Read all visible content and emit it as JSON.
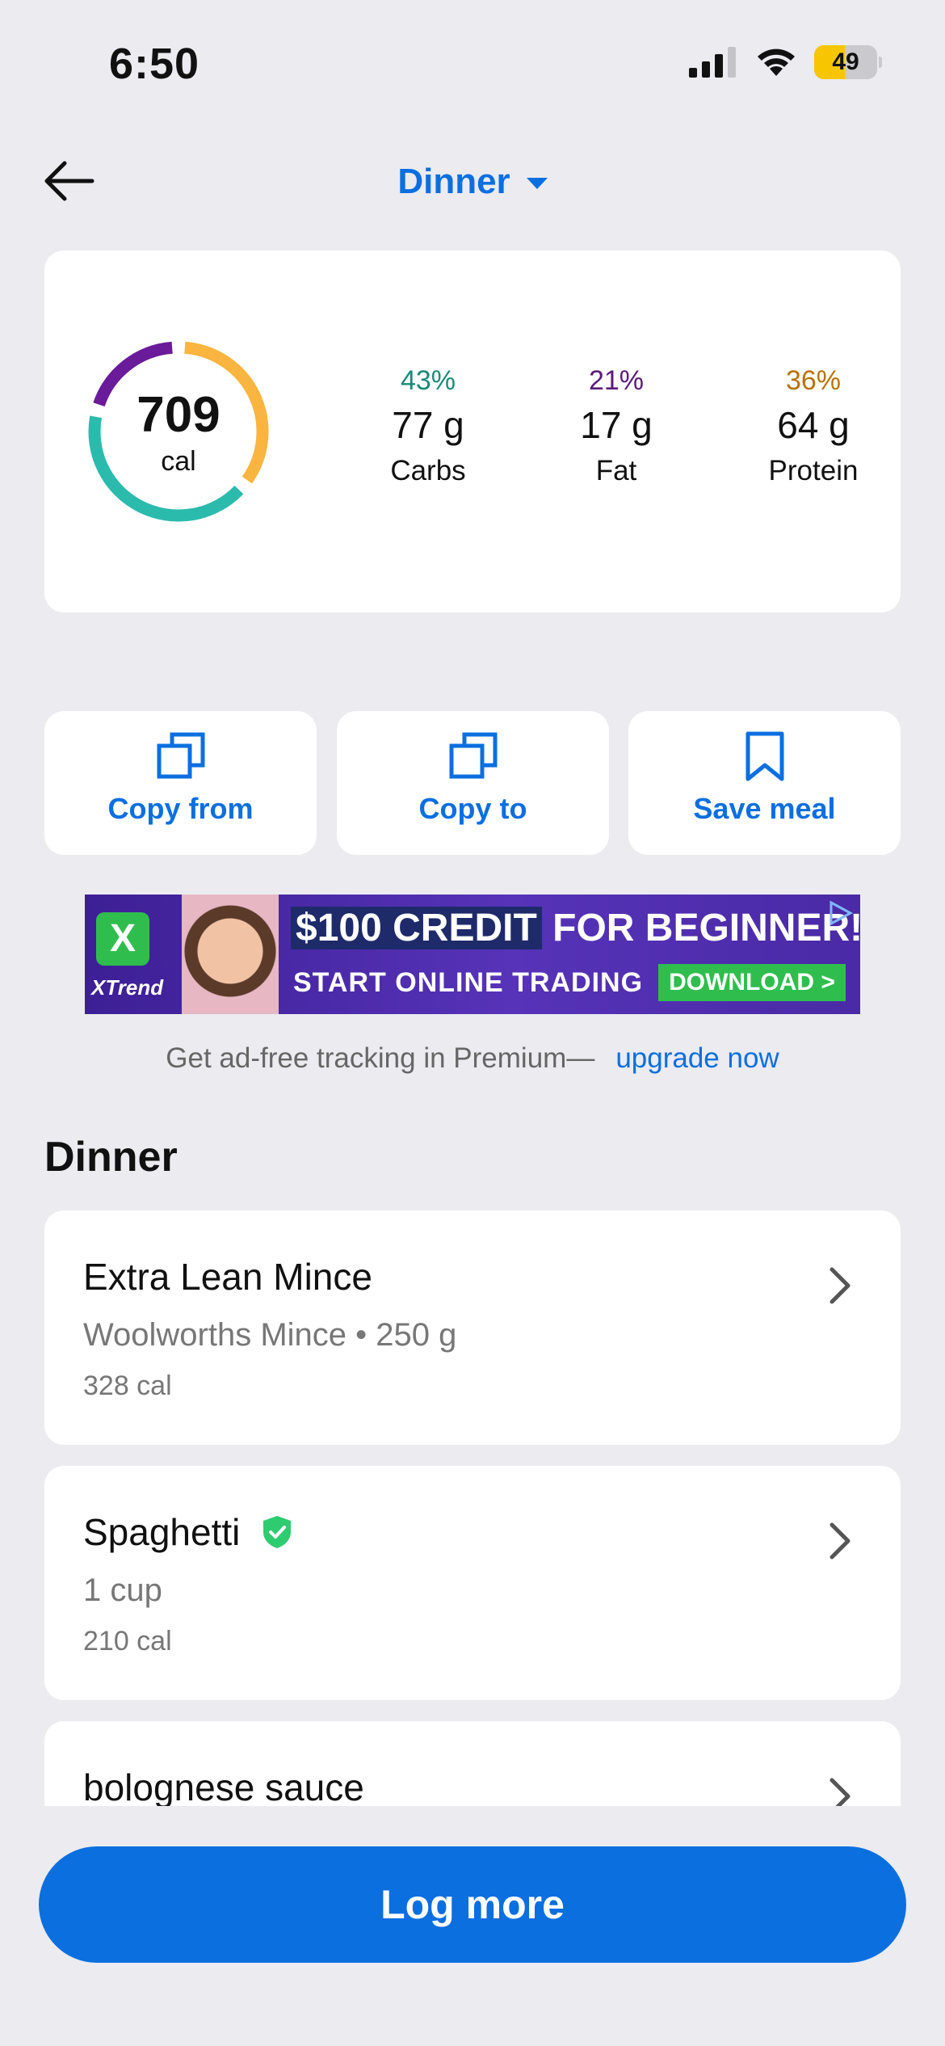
{
  "status_bar": {
    "time": "6:50",
    "battery": "49",
    "battery_level": 0.49
  },
  "header": {
    "title": "Dinner",
    "back_icon": "arrow-left-icon",
    "dropdown_icon": "caret-down-icon"
  },
  "summary": {
    "calories": "709",
    "calories_unit": "cal",
    "ring_segments": [
      {
        "macro": "Carbs",
        "fraction": 0.43,
        "color": "#2bbbad"
      },
      {
        "macro": "Fat",
        "fraction": 0.21,
        "color": "#6a1b9a"
      },
      {
        "macro": "Protein",
        "fraction": 0.36,
        "color": "#f9b540"
      }
    ],
    "macros": [
      {
        "pct": "43%",
        "grams": "77 g",
        "name": "Carbs",
        "color": "#1a8a7a"
      },
      {
        "pct": "21%",
        "grams": "17 g",
        "name": "Fat",
        "color": "#5b1a7a"
      },
      {
        "pct": "36%",
        "grams": "64 g",
        "name": "Protein",
        "color": "#b77400"
      }
    ]
  },
  "actions": [
    {
      "label": "Copy from",
      "icon": "copy-icon"
    },
    {
      "label": "Copy to",
      "icon": "copy-icon"
    },
    {
      "label": "Save meal",
      "icon": "bookmark-icon"
    }
  ],
  "ad": {
    "brand": "XTrend",
    "headline_highlight": "$100 CREDIT",
    "headline_rest": " FOR BEGINNER!",
    "sub": "START ONLINE TRADING",
    "cta": "DOWNLOAD >"
  },
  "premium": {
    "text": "Get ad-free tracking in Premium—",
    "link": "upgrade now"
  },
  "section_title": "Dinner",
  "foods": [
    {
      "name": "Extra Lean Mince",
      "detail": "Woolworths Mince • 250 g",
      "calories": "328 cal",
      "verified": false
    },
    {
      "name": "Spaghetti",
      "detail": "1 cup",
      "calories": "210 cal",
      "verified": true
    },
    {
      "name": "bolognese sauce",
      "detail": "",
      "calories": "",
      "verified": false
    }
  ],
  "log_more": "Log more",
  "colors": {
    "accent": "#0b6fe0",
    "background": "#ebebf0"
  }
}
